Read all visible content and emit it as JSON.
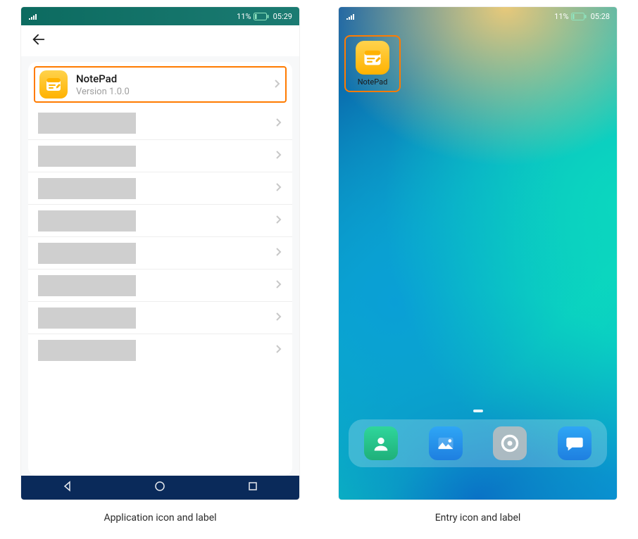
{
  "left": {
    "status": {
      "battery": "11%",
      "time": "05:29"
    },
    "app": {
      "name": "NotePad",
      "version": "Version 1.0.0"
    },
    "placeholder_rows": 8,
    "caption": "Application icon and label"
  },
  "right": {
    "status": {
      "battery": "11%",
      "time": "05:28"
    },
    "home_app": {
      "label": "NotePad"
    },
    "caption": "Entry icon and label"
  }
}
